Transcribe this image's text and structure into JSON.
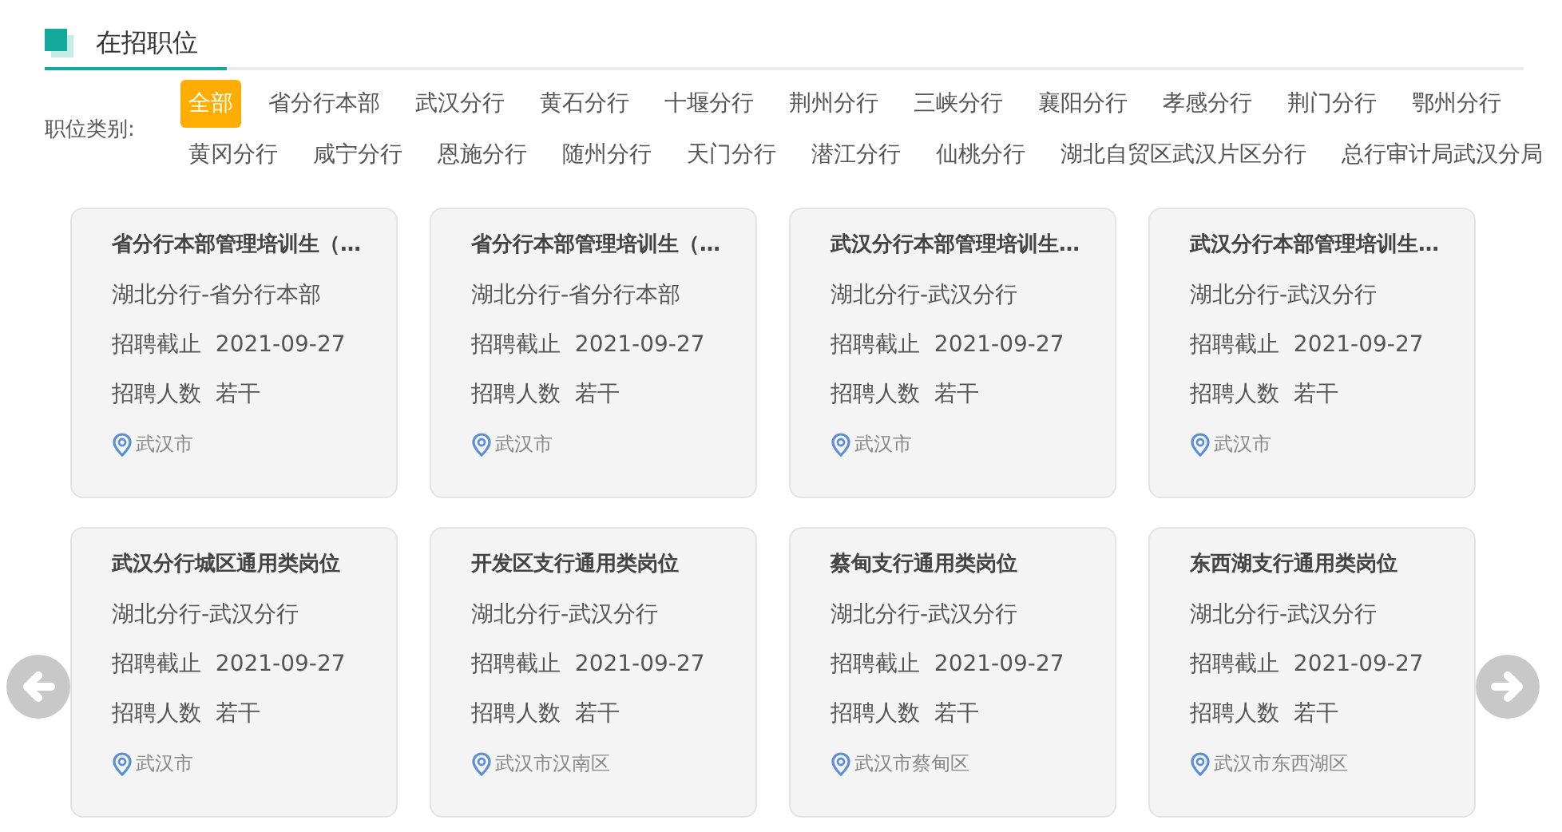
{
  "section": {
    "title": "在招职位"
  },
  "filter": {
    "label": "职位类别:",
    "categories": [
      {
        "label": "全部",
        "selected": true
      },
      {
        "label": "省分行本部",
        "selected": false
      },
      {
        "label": "武汉分行",
        "selected": false
      },
      {
        "label": "黄石分行",
        "selected": false
      },
      {
        "label": "十堰分行",
        "selected": false
      },
      {
        "label": "荆州分行",
        "selected": false
      },
      {
        "label": "三峡分行",
        "selected": false
      },
      {
        "label": "襄阳分行",
        "selected": false
      },
      {
        "label": "孝感分行",
        "selected": false
      },
      {
        "label": "荆门分行",
        "selected": false
      },
      {
        "label": "鄂州分行",
        "selected": false
      },
      {
        "label": "黄冈分行",
        "selected": false
      },
      {
        "label": "咸宁分行",
        "selected": false
      },
      {
        "label": "恩施分行",
        "selected": false
      },
      {
        "label": "随州分行",
        "selected": false
      },
      {
        "label": "天门分行",
        "selected": false
      },
      {
        "label": "潜江分行",
        "selected": false
      },
      {
        "label": "仙桃分行",
        "selected": false
      },
      {
        "label": "湖北自贸区武汉片区分行",
        "selected": false
      },
      {
        "label": "总行审计局武汉分局",
        "selected": false
      }
    ]
  },
  "jobs": [
    {
      "title": "省分行本部管理培训生（…",
      "org": "湖北分行-省分行本部",
      "deadline_label": "招聘截止",
      "deadline": "2021-09-27",
      "count_label": "招聘人数",
      "count": "若干",
      "location": "武汉市"
    },
    {
      "title": "省分行本部管理培训生（…",
      "org": "湖北分行-省分行本部",
      "deadline_label": "招聘截止",
      "deadline": "2021-09-27",
      "count_label": "招聘人数",
      "count": "若干",
      "location": "武汉市"
    },
    {
      "title": "武汉分行本部管理培训生…",
      "org": "湖北分行-武汉分行",
      "deadline_label": "招聘截止",
      "deadline": "2021-09-27",
      "count_label": "招聘人数",
      "count": "若干",
      "location": "武汉市"
    },
    {
      "title": "武汉分行本部管理培训生…",
      "org": "湖北分行-武汉分行",
      "deadline_label": "招聘截止",
      "deadline": "2021-09-27",
      "count_label": "招聘人数",
      "count": "若干",
      "location": "武汉市"
    },
    {
      "title": "武汉分行城区通用类岗位",
      "org": "湖北分行-武汉分行",
      "deadline_label": "招聘截止",
      "deadline": "2021-09-27",
      "count_label": "招聘人数",
      "count": "若干",
      "location": "武汉市"
    },
    {
      "title": "开发区支行通用类岗位",
      "org": "湖北分行-武汉分行",
      "deadline_label": "招聘截止",
      "deadline": "2021-09-27",
      "count_label": "招聘人数",
      "count": "若干",
      "location": "武汉市汉南区"
    },
    {
      "title": "蔡甸支行通用类岗位",
      "org": "湖北分行-武汉分行",
      "deadline_label": "招聘截止",
      "deadline": "2021-09-27",
      "count_label": "招聘人数",
      "count": "若干",
      "location": "武汉市蔡甸区"
    },
    {
      "title": "东西湖支行通用类岗位",
      "org": "湖北分行-武汉分行",
      "deadline_label": "招聘截止",
      "deadline": "2021-09-27",
      "count_label": "招聘人数",
      "count": "若干",
      "location": "武汉市东西湖区"
    }
  ]
}
